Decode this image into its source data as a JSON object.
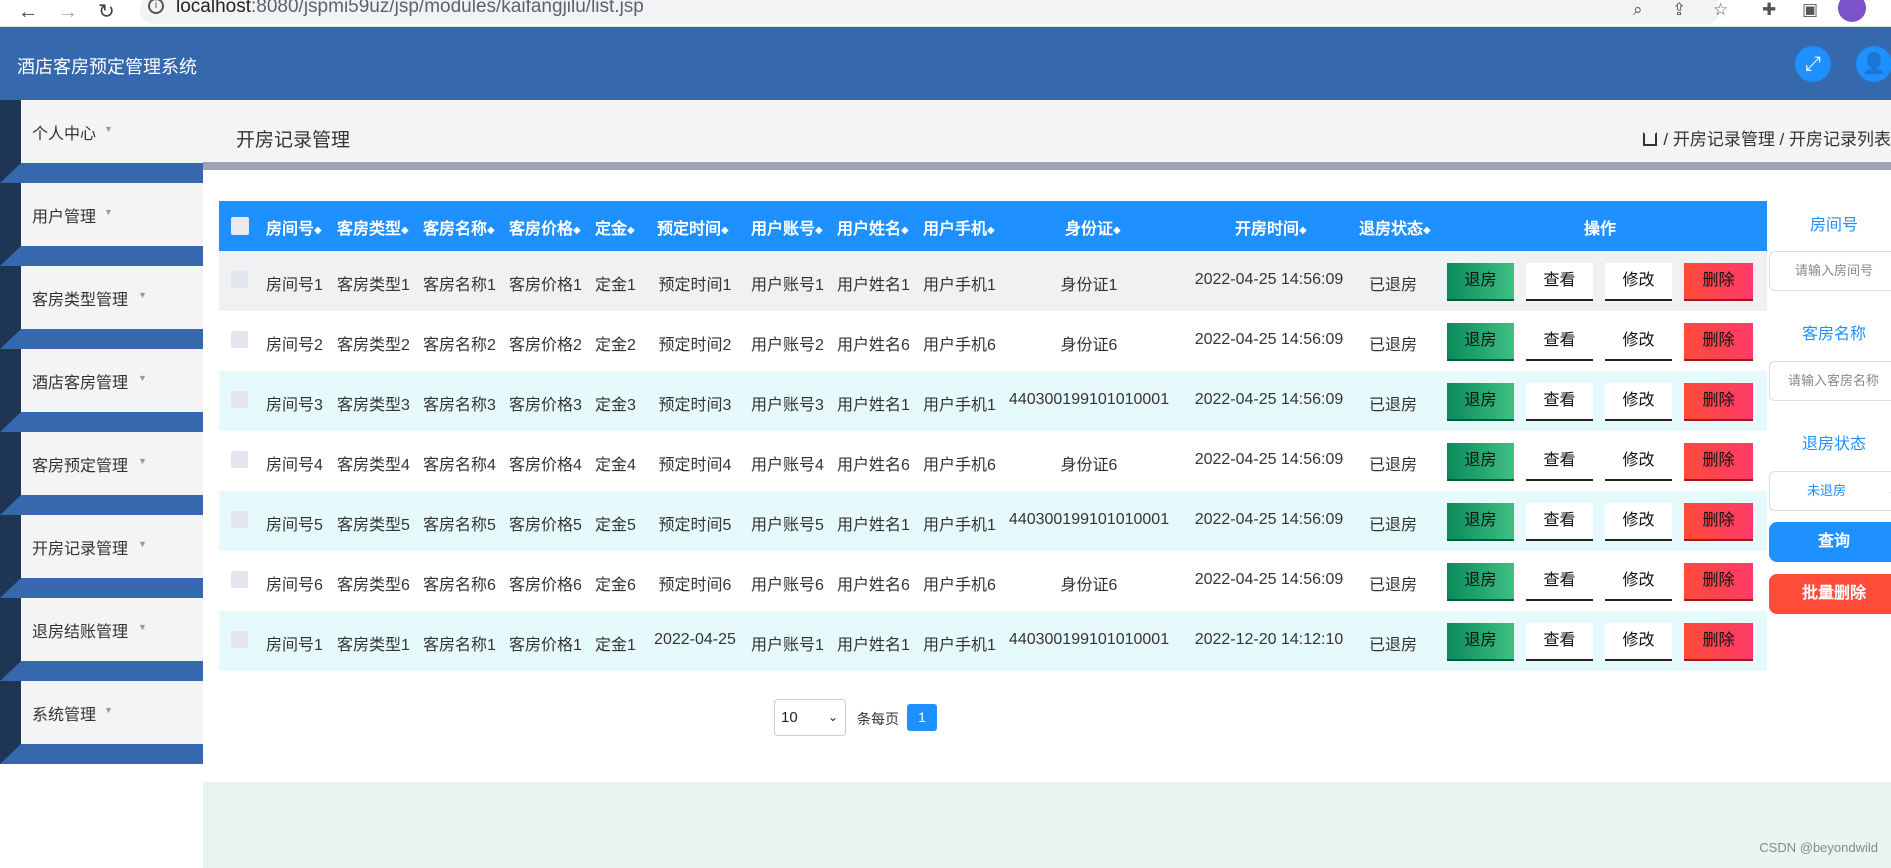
{
  "browser": {
    "url_host": "localhost",
    "url_path": ":8080/jspmi59uz/jsp/modules/kaifangjilu/list.jsp"
  },
  "app": {
    "title": "酒店客房预定管理系统"
  },
  "sidebar": {
    "items": [
      {
        "label": "个人中心"
      },
      {
        "label": "用户管理"
      },
      {
        "label": "客房类型管理"
      },
      {
        "label": "酒店客房管理"
      },
      {
        "label": "客房预定管理"
      },
      {
        "label": "开房记录管理"
      },
      {
        "label": "退房结账管理"
      },
      {
        "label": "系统管理"
      }
    ]
  },
  "page": {
    "title": "开房记录管理",
    "breadcrumb": "/ 开房记录管理 / 开房记录列表"
  },
  "table": {
    "columns": [
      "房间号",
      "客房类型",
      "客房名称",
      "客房价格",
      "定金",
      "预定时间",
      "用户账号",
      "用户姓名",
      "用户手机",
      "身份证",
      "开房时间",
      "退房状态",
      "操作"
    ],
    "sort_glyph": "◆",
    "rows": [
      [
        "房间号1",
        "客房类型1",
        "客房名称1",
        "客房价格1",
        "定金1",
        "预定时间1",
        "用户账号1",
        "用户姓名1",
        "用户手机1",
        "身份证1",
        "2022-04-25 14:56:09",
        "已退房"
      ],
      [
        "房间号2",
        "客房类型2",
        "客房名称2",
        "客房价格2",
        "定金2",
        "预定时间2",
        "用户账号2",
        "用户姓名6",
        "用户手机6",
        "身份证6",
        "2022-04-25 14:56:09",
        "已退房"
      ],
      [
        "房间号3",
        "客房类型3",
        "客房名称3",
        "客房价格3",
        "定金3",
        "预定时间3",
        "用户账号3",
        "用户姓名1",
        "用户手机1",
        "440300199101010001",
        "2022-04-25 14:56:09",
        "已退房"
      ],
      [
        "房间号4",
        "客房类型4",
        "客房名称4",
        "客房价格4",
        "定金4",
        "预定时间4",
        "用户账号4",
        "用户姓名6",
        "用户手机6",
        "身份证6",
        "2022-04-25 14:56:09",
        "已退房"
      ],
      [
        "房间号5",
        "客房类型5",
        "客房名称5",
        "客房价格5",
        "定金5",
        "预定时间5",
        "用户账号5",
        "用户姓名1",
        "用户手机1",
        "440300199101010001",
        "2022-04-25 14:56:09",
        "已退房"
      ],
      [
        "房间号6",
        "客房类型6",
        "客房名称6",
        "客房价格6",
        "定金6",
        "预定时间6",
        "用户账号6",
        "用户姓名6",
        "用户手机6",
        "身份证6",
        "2022-04-25 14:56:09",
        "已退房"
      ],
      [
        "房间号1",
        "客房类型1",
        "客房名称1",
        "客房价格1",
        "定金1",
        "2022-04-25",
        "用户账号1",
        "用户姓名1",
        "用户手机1",
        "440300199101010001",
        "2022-12-20 14:12:10",
        "已退房"
      ]
    ],
    "actions": {
      "checkout": "退房",
      "view": "查看",
      "edit": "修改",
      "delete": "删除"
    }
  },
  "pagination": {
    "page_size": "10",
    "per_page_label": "条每页",
    "current_page": "1"
  },
  "search": {
    "room_no_label": "房间号",
    "room_no_placeholder": "请输入房间号",
    "room_name_label": "客房名称",
    "room_name_placeholder": "请输入客房名称",
    "status_label": "退房状态",
    "status_value": "未退房",
    "query_button": "查询",
    "batch_delete_button": "批量删除"
  },
  "watermark": "CSDN @beyondwild",
  "colors": {
    "header_blue": "#3568ad",
    "accent_blue": "#1e90ff",
    "danger_red": "#ff4b3a",
    "success_green": "#0a8a5a"
  }
}
